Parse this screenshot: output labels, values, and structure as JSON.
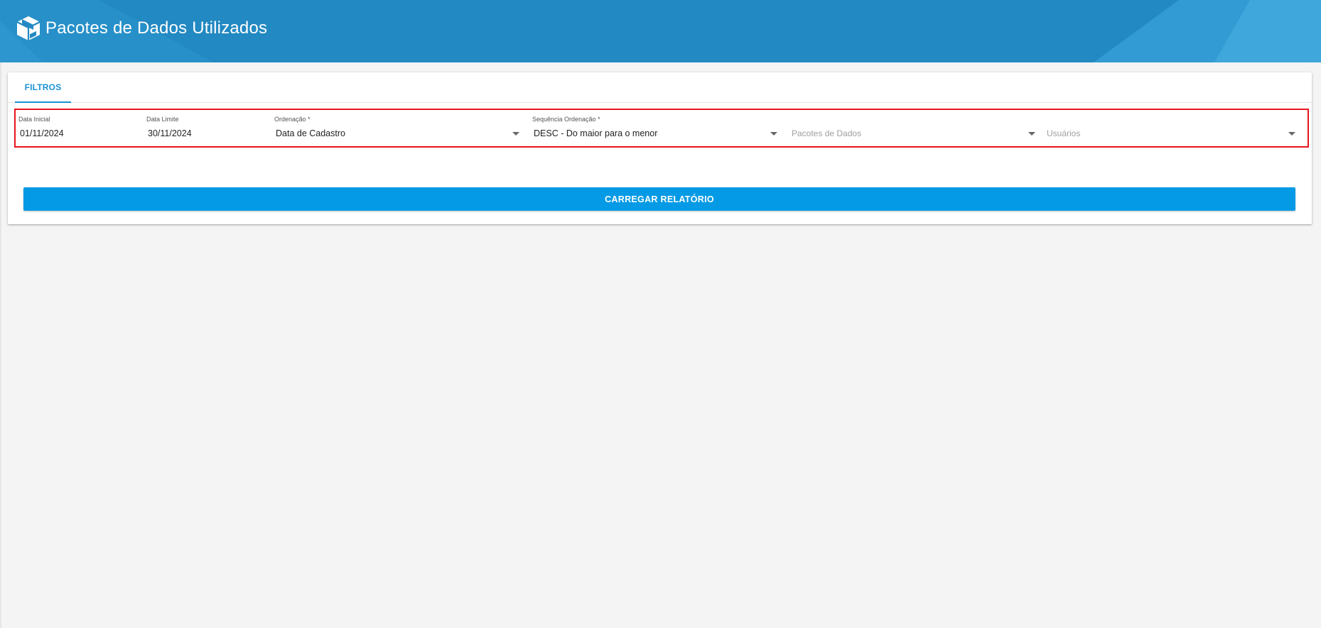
{
  "header": {
    "title": "Pacotes de Dados Utilizados",
    "logo_icon": "package-box-icon",
    "background_color": "#2289c2"
  },
  "tabs": [
    {
      "label": "FILTROS",
      "active": true
    }
  ],
  "filters": {
    "data_inicial": {
      "label": "Data Inicial",
      "value": "01/11/2024"
    },
    "data_limite": {
      "label": "Data Limite",
      "value": "30/11/2024"
    },
    "ordenacao": {
      "label": "Ordenação *",
      "value": "Data de Cadastro"
    },
    "sequencia_ordenacao": {
      "label": "Sequência Ordenação *",
      "value": "DESC - Do maior para o menor"
    },
    "pacotes_de_dados": {
      "placeholder": "Pacotes de Dados"
    },
    "usuarios": {
      "placeholder": "Usuários"
    },
    "highlight_color": "#e8141c"
  },
  "actions": {
    "load_report_label": "CARREGAR RELATÓRIO",
    "button_color": "#049ae5"
  }
}
